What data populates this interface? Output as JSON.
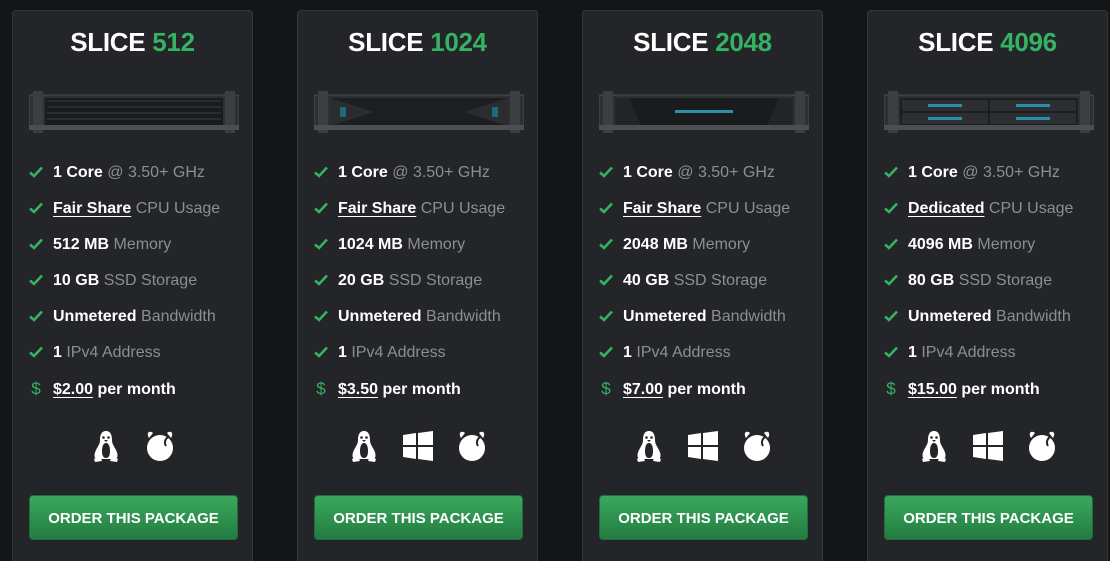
{
  "colors": {
    "accent": "#35b363",
    "card_bg": "#232528",
    "page_bg": "#141517",
    "muted_text": "#8c8e91"
  },
  "plans": [
    {
      "name": "SLICE",
      "size": "512",
      "features": {
        "cores": "1 Core",
        "clock": "@ 3.50+ GHz",
        "cpu_share": "Fair Share",
        "cpu_label": "CPU Usage",
        "memory": "512 MB",
        "memory_label": "Memory",
        "storage": "10 GB",
        "storage_label": "SSD Storage",
        "bandwidth": "Unmetered",
        "bandwidth_label": "Bandwidth",
        "ipv4": "1",
        "ipv4_label": "IPv4 Address",
        "currency": "$",
        "price": "$2.00",
        "period": "per month"
      },
      "os_icons": [
        "linux-icon",
        "freebsd-icon"
      ],
      "button_label": "ORDER THIS PACKAGE"
    },
    {
      "name": "SLICE",
      "size": "1024",
      "features": {
        "cores": "1 Core",
        "clock": "@ 3.50+ GHz",
        "cpu_share": "Fair Share",
        "cpu_label": "CPU Usage",
        "memory": "1024 MB",
        "memory_label": "Memory",
        "storage": "20 GB",
        "storage_label": "SSD Storage",
        "bandwidth": "Unmetered",
        "bandwidth_label": "Bandwidth",
        "ipv4": "1",
        "ipv4_label": "IPv4 Address",
        "currency": "$",
        "price": "$3.50",
        "period": "per month"
      },
      "os_icons": [
        "linux-icon",
        "windows-icon",
        "freebsd-icon"
      ],
      "button_label": "ORDER THIS PACKAGE"
    },
    {
      "name": "SLICE",
      "size": "2048",
      "features": {
        "cores": "1 Core",
        "clock": "@ 3.50+ GHz",
        "cpu_share": "Fair Share",
        "cpu_label": "CPU Usage",
        "memory": "2048 MB",
        "memory_label": "Memory",
        "storage": "40 GB",
        "storage_label": "SSD Storage",
        "bandwidth": "Unmetered",
        "bandwidth_label": "Bandwidth",
        "ipv4": "1",
        "ipv4_label": "IPv4 Address",
        "currency": "$",
        "price": "$7.00",
        "period": "per month"
      },
      "os_icons": [
        "linux-icon",
        "windows-icon",
        "freebsd-icon"
      ],
      "button_label": "ORDER THIS PACKAGE"
    },
    {
      "name": "SLICE",
      "size": "4096",
      "features": {
        "cores": "1 Core",
        "clock": "@ 3.50+ GHz",
        "cpu_share": "Dedicated",
        "cpu_label": "CPU Usage",
        "memory": "4096 MB",
        "memory_label": "Memory",
        "storage": "80 GB",
        "storage_label": "SSD Storage",
        "bandwidth": "Unmetered",
        "bandwidth_label": "Bandwidth",
        "ipv4": "1",
        "ipv4_label": "IPv4 Address",
        "currency": "$",
        "price": "$15.00",
        "period": "per month"
      },
      "os_icons": [
        "linux-icon",
        "windows-icon",
        "freebsd-icon"
      ],
      "button_label": "ORDER THIS PACKAGE"
    }
  ]
}
